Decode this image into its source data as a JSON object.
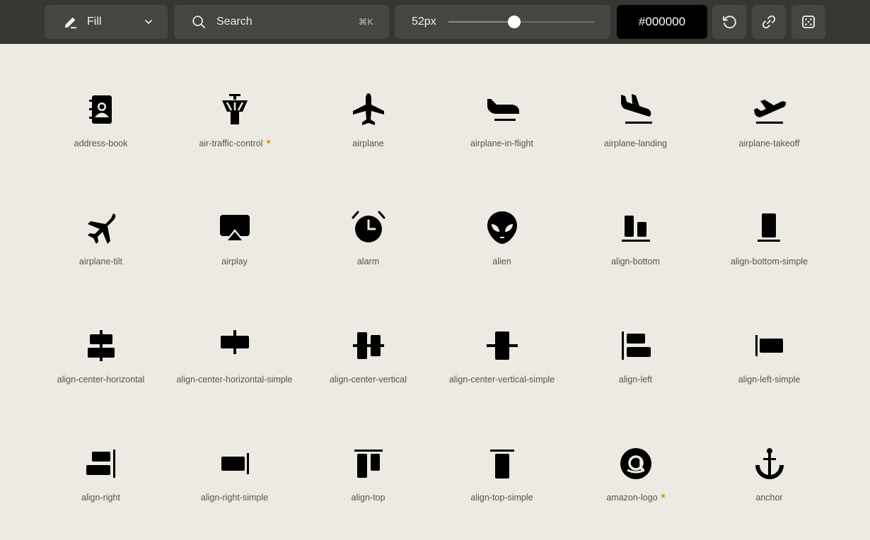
{
  "toolbar": {
    "weight": {
      "label": "Fill",
      "icon": "pencil-icon"
    },
    "search": {
      "placeholder": "Search",
      "shortcut": "⌘K"
    },
    "size": {
      "label": "52px",
      "value": 52,
      "min": 16,
      "max": 96
    },
    "color": {
      "label": "#000000"
    }
  },
  "accent": "#e0a310",
  "icons": [
    {
      "name": "address-book",
      "new": false
    },
    {
      "name": "air-traffic-control",
      "new": true
    },
    {
      "name": "airplane",
      "new": false
    },
    {
      "name": "airplane-in-flight",
      "new": false
    },
    {
      "name": "airplane-landing",
      "new": false
    },
    {
      "name": "airplane-takeoff",
      "new": false
    },
    {
      "name": "airplane-tilt",
      "new": false
    },
    {
      "name": "airplay",
      "new": false
    },
    {
      "name": "alarm",
      "new": false
    },
    {
      "name": "alien",
      "new": false
    },
    {
      "name": "align-bottom",
      "new": false
    },
    {
      "name": "align-bottom-simple",
      "new": false
    },
    {
      "name": "align-center-horizontal",
      "new": false
    },
    {
      "name": "align-center-horizontal-simple",
      "new": false
    },
    {
      "name": "align-center-vertical",
      "new": false
    },
    {
      "name": "align-center-vertical-simple",
      "new": false
    },
    {
      "name": "align-left",
      "new": false
    },
    {
      "name": "align-left-simple",
      "new": false
    },
    {
      "name": "align-right",
      "new": false
    },
    {
      "name": "align-right-simple",
      "new": false
    },
    {
      "name": "align-top",
      "new": false
    },
    {
      "name": "align-top-simple",
      "new": false
    },
    {
      "name": "amazon-logo",
      "new": true
    },
    {
      "name": "anchor",
      "new": false
    }
  ]
}
